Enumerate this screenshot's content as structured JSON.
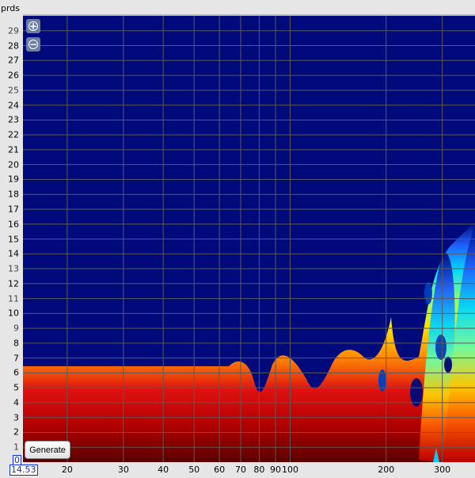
{
  "unit_label": "prds",
  "y_ticks": [
    "29",
    "28",
    "27",
    "26",
    "25",
    "24",
    "23",
    "22",
    "21",
    "20",
    "19",
    "18",
    "17",
    "16",
    "15",
    "14",
    "13",
    "12",
    "11",
    "10",
    "9",
    "8",
    "7",
    "6",
    "5",
    "4",
    "3",
    "2",
    "1"
  ],
  "y_origin_label": "0",
  "x_ticks": [
    "20",
    "30",
    "40",
    "50",
    "60",
    "70",
    "80",
    "90",
    "100",
    "200",
    "300"
  ],
  "x_start_label": "14.53",
  "generate_label": "Generate",
  "colors": {
    "plot_background": "#000a7a",
    "grid": "#5a5a5a",
    "box_label": "#1030d0"
  },
  "icons": {
    "zoom_in": "zoom-in-icon",
    "zoom_out": "zoom-out-icon"
  }
}
